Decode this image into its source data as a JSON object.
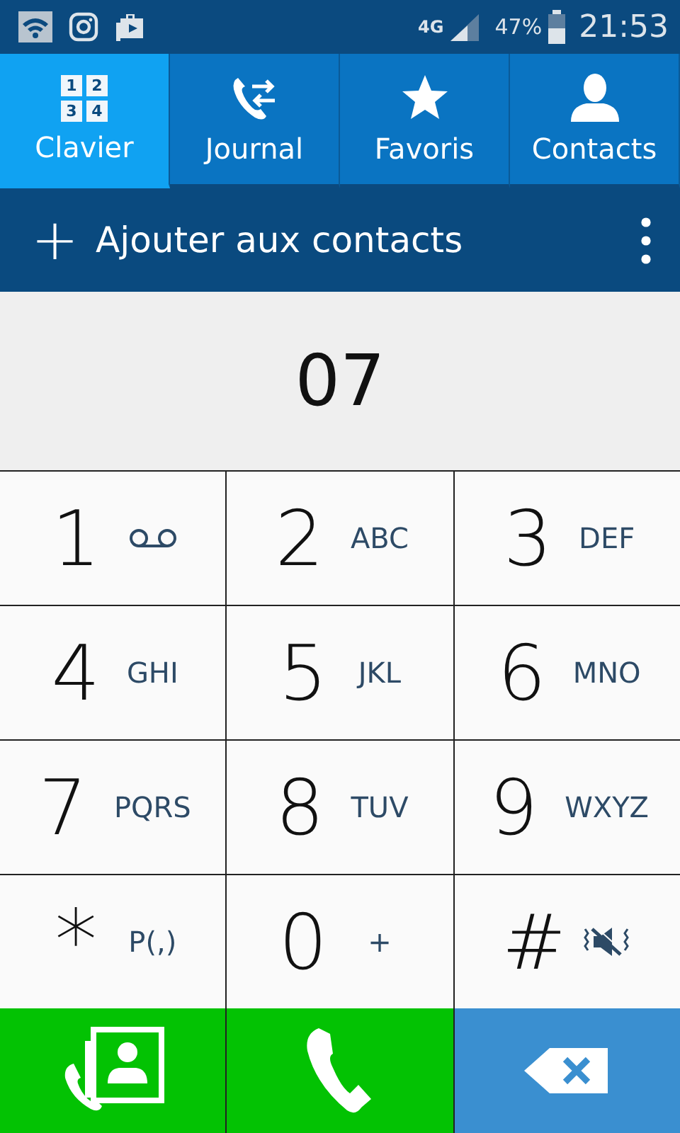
{
  "status_bar": {
    "network": "4G",
    "battery": "47%",
    "time": "21:53"
  },
  "tabs": [
    {
      "label": "Clavier",
      "kind": "keypad",
      "icon_digits": [
        "1",
        "2",
        "3",
        "4"
      ],
      "selected": true
    },
    {
      "label": "Journal",
      "kind": "log",
      "selected": false
    },
    {
      "label": "Favoris",
      "kind": "star",
      "selected": false
    },
    {
      "label": "Contacts",
      "kind": "person",
      "selected": false
    }
  ],
  "action_bar": {
    "add_icon": "+",
    "label": "Ajouter aux contacts"
  },
  "display": {
    "number": "07"
  },
  "keys": [
    {
      "digit": "1",
      "kind": "voicemail"
    },
    {
      "digit": "2",
      "kind": "letters",
      "letters": "ABC"
    },
    {
      "digit": "3",
      "kind": "letters",
      "letters": "DEF"
    },
    {
      "digit": "4",
      "kind": "letters",
      "letters": "GHI"
    },
    {
      "digit": "5",
      "kind": "letters",
      "letters": "JKL"
    },
    {
      "digit": "6",
      "kind": "letters",
      "letters": "MNO"
    },
    {
      "digit": "7",
      "kind": "letters",
      "letters": "PQRS"
    },
    {
      "digit": "8",
      "kind": "letters",
      "letters": "TUV"
    },
    {
      "digit": "9",
      "kind": "letters",
      "letters": "WXYZ"
    },
    {
      "digit": "*",
      "kind": "letters",
      "letters": "P(,)"
    },
    {
      "digit": "0",
      "kind": "letters",
      "letters": "+"
    },
    {
      "digit": "#",
      "kind": "silent"
    }
  ],
  "bottom_buttons": [
    {
      "kind": "video-call"
    },
    {
      "kind": "call"
    },
    {
      "kind": "delete"
    }
  ]
}
